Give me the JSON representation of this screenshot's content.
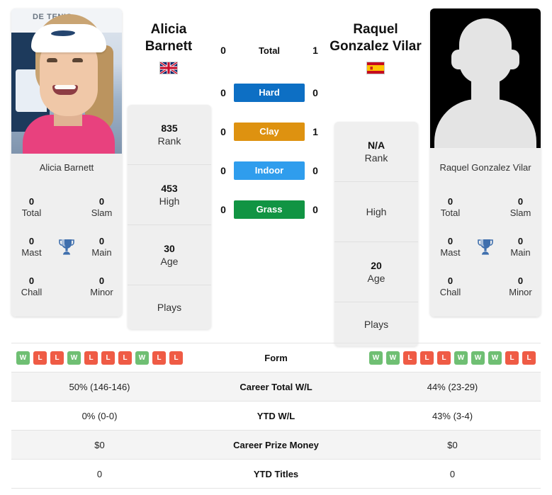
{
  "players": {
    "left": {
      "first_name": "Alicia",
      "last_name": "Barnett",
      "full_name": "Alicia Barnett",
      "country": "GB",
      "flag_icon": "flag-united-kingdom",
      "photo_type": "player-photo",
      "photo_banner_text": "DE TENIS",
      "rank": "835",
      "rank_label": "Rank",
      "high": "453",
      "high_label": "High",
      "age": "30",
      "age_label": "Age",
      "plays_label": "Plays",
      "plays_value": "",
      "titles": {
        "total": "0",
        "total_label": "Total",
        "slam": "0",
        "slam_label": "Slam",
        "mast": "0",
        "mast_label": "Mast",
        "main": "0",
        "main_label": "Main",
        "chall": "0",
        "chall_label": "Chall",
        "minor": "0",
        "minor_label": "Minor"
      },
      "form": [
        "W",
        "L",
        "L",
        "W",
        "L",
        "L",
        "L",
        "W",
        "L",
        "L"
      ],
      "career_total_wl": "50% (146-146)",
      "ytd_wl": "0% (0-0)",
      "career_prize_money": "$0",
      "ytd_titles": "0"
    },
    "right": {
      "first_name": "Raquel",
      "last_name": "Gonzalez Vilar",
      "full_name": "Raquel Gonzalez Vilar",
      "country": "ES",
      "flag_icon": "flag-spain",
      "photo_type": "silhouette-placeholder",
      "rank": "N/A",
      "rank_label": "Rank",
      "high": "",
      "high_label": "High",
      "age": "20",
      "age_label": "Age",
      "plays_label": "Plays",
      "plays_value": "",
      "titles": {
        "total": "0",
        "total_label": "Total",
        "slam": "0",
        "slam_label": "Slam",
        "mast": "0",
        "mast_label": "Mast",
        "main": "0",
        "main_label": "Main",
        "chall": "0",
        "chall_label": "Chall",
        "minor": "0",
        "minor_label": "Minor"
      },
      "form": [
        "W",
        "W",
        "L",
        "L",
        "L",
        "W",
        "W",
        "W",
        "L",
        "L"
      ],
      "career_total_wl": "44% (23-29)",
      "ytd_wl": "43% (3-4)",
      "career_prize_money": "$0",
      "ytd_titles": "0"
    }
  },
  "head_to_head": [
    {
      "label": "Total",
      "left": "0",
      "right": "1",
      "type": "text",
      "color": ""
    },
    {
      "label": "Hard",
      "left": "0",
      "right": "0",
      "type": "pill",
      "color": "#0d6fc4"
    },
    {
      "label": "Clay",
      "left": "0",
      "right": "1",
      "type": "pill",
      "color": "#de9210"
    },
    {
      "label": "Indoor",
      "left": "0",
      "right": "0",
      "type": "pill",
      "color": "#2f9ded"
    },
    {
      "label": "Grass",
      "left": "0",
      "right": "0",
      "type": "pill",
      "color": "#119443"
    }
  ],
  "stats_rows": [
    {
      "label": "Form",
      "left": "",
      "right": "",
      "type": "form"
    },
    {
      "label": "Career Total W/L",
      "left": "50% (146-146)",
      "right": "44% (23-29)",
      "type": "text"
    },
    {
      "label": "YTD W/L",
      "left": "0% (0-0)",
      "right": "43% (3-4)",
      "type": "text"
    },
    {
      "label": "Career Prize Money",
      "left": "$0",
      "right": "$0",
      "type": "text"
    },
    {
      "label": "YTD Titles",
      "left": "0",
      "right": "0",
      "type": "text"
    }
  ],
  "icons": {
    "trophy": "trophy-icon"
  },
  "colors": {
    "hard": "#0d6fc4",
    "clay": "#de9210",
    "indoor": "#2f9ded",
    "grass": "#119443",
    "win_badge": "#6fbf73",
    "loss_badge": "#ef5b45",
    "card_bg": "#efefef",
    "row_alt_bg": "#f4f4f4"
  }
}
